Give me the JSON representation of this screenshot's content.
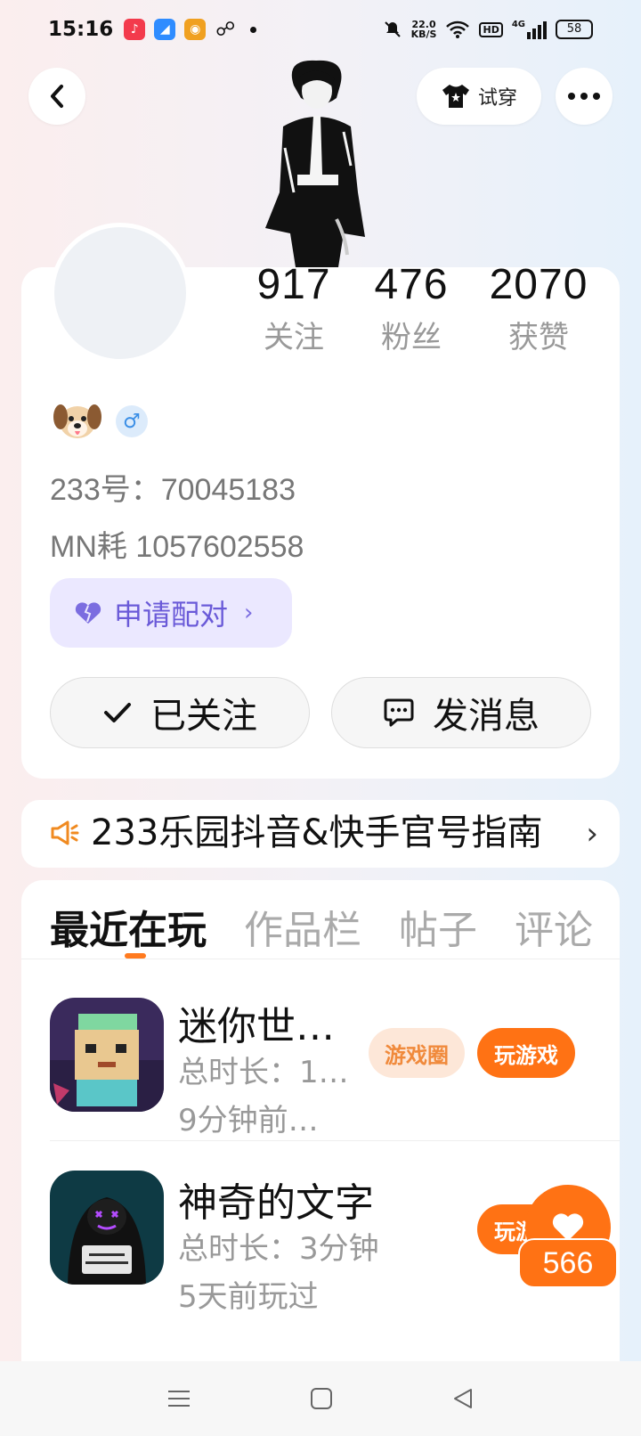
{
  "status_bar": {
    "time": "15:16",
    "net_speed": "22.0",
    "net_unit": "KB/S",
    "hd": "HD",
    "signal": "4G",
    "battery": "58"
  },
  "header": {
    "try_on_label": "试穿"
  },
  "profile": {
    "stats": [
      {
        "value": "917",
        "label": "关注"
      },
      {
        "value": "476",
        "label": "粉丝"
      },
      {
        "value": "2070",
        "label": "获赞"
      }
    ],
    "gender_symbol": "♂",
    "id_line": "233号：70045183",
    "nickname_line": "MN耗 1057602558",
    "pair_label": "申请配对",
    "follow_label": "已关注",
    "message_label": "发消息"
  },
  "notice": {
    "text": "233乐园抖音&快手官号指南"
  },
  "tabs": [
    "最近在玩",
    "作品栏",
    "帖子",
    "评论"
  ],
  "games": [
    {
      "title": "迷你世…",
      "duration": "总时长：1…",
      "last_played": "9分钟前…",
      "circle_label": "游戏圈",
      "play_label": "玩游戏"
    },
    {
      "title": "神奇的文字",
      "duration": "总时长：3分钟",
      "last_played": "5天前玩过",
      "play_label": "玩游戏"
    }
  ],
  "like_count": "566",
  "colors": {
    "accent": "#ff7214",
    "pair_bg": "#ebe8ff",
    "pair_text": "#6a5ad8"
  }
}
